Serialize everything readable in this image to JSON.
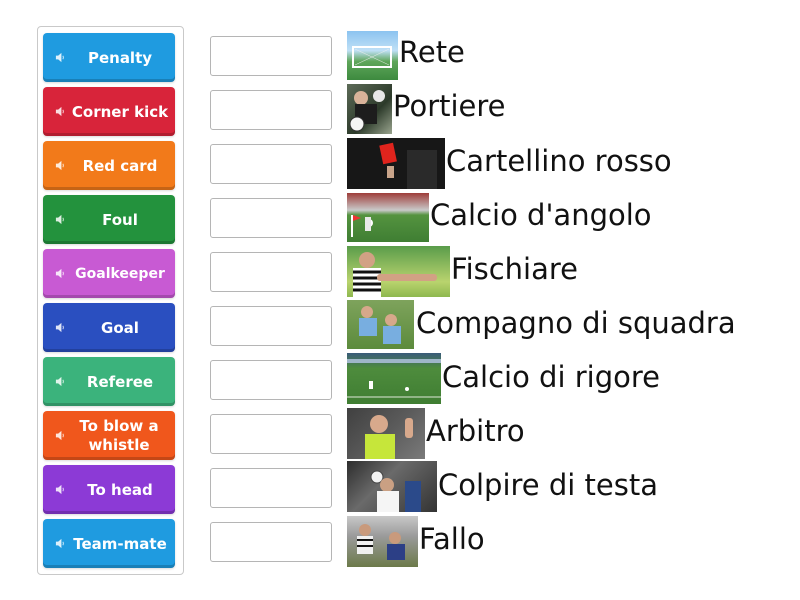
{
  "tiles": [
    {
      "label": "Penalty",
      "color": "#1f9be0"
    },
    {
      "label": "Corner kick",
      "color": "#d8243a"
    },
    {
      "label": "Red card",
      "color": "#f27a1a"
    },
    {
      "label": "Foul",
      "color": "#23923d"
    },
    {
      "label": "Goalkeeper",
      "color": "#c85ad3"
    },
    {
      "label": "Goal",
      "color": "#2a4fc0"
    },
    {
      "label": "Referee",
      "color": "#3bb37c"
    },
    {
      "label": "To blow a whistle",
      "color": "#f0571c"
    },
    {
      "label": "To head",
      "color": "#8c3ad6"
    },
    {
      "label": "Team-mate",
      "color": "#1f9be0"
    }
  ],
  "prompts": [
    {
      "word": "Rete",
      "image_icon": "goal-net-photo-icon"
    },
    {
      "word": "Portiere",
      "image_icon": "goalkeeper-photo-icon"
    },
    {
      "word": "Cartellino rosso",
      "image_icon": "red-card-photo-icon"
    },
    {
      "word": "Calcio d'angolo",
      "image_icon": "corner-kick-photo-icon"
    },
    {
      "word": "Fischiare",
      "image_icon": "whistle-photo-icon"
    },
    {
      "word": "Compagno di squadra",
      "image_icon": "team-mate-photo-icon"
    },
    {
      "word": "Calcio di rigore",
      "image_icon": "penalty-photo-icon"
    },
    {
      "word": "Arbitro",
      "image_icon": "referee-photo-icon"
    },
    {
      "word": "Colpire di testa",
      "image_icon": "header-photo-icon"
    },
    {
      "word": "Fallo",
      "image_icon": "foul-photo-icon"
    }
  ]
}
